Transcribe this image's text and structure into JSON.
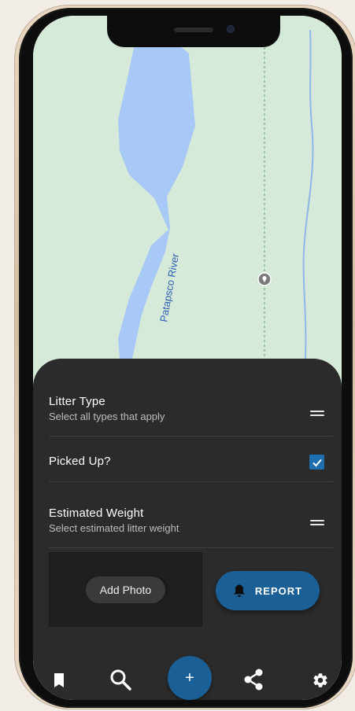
{
  "map": {
    "river_label": "Patapsco River",
    "colors": {
      "land": "#d5ead8",
      "water": "#a8c8f7",
      "river_label": "#2f5fb6"
    }
  },
  "form": {
    "litter_type": {
      "title": "Litter Type",
      "subtitle": "Select all types that apply"
    },
    "picked_up": {
      "title": "Picked Up?",
      "checked": true
    },
    "estimated_weight": {
      "title": "Estimated Weight",
      "subtitle": "Select estimated litter weight"
    }
  },
  "actions": {
    "add_photo_label": "Add Photo",
    "report_label": "REPORT"
  },
  "nav": {
    "fab_label": "+",
    "icons": [
      "bookmark-icon",
      "search-icon",
      "add-icon",
      "share-icon",
      "gear-icon"
    ]
  },
  "theme": {
    "accent": "#1a5f96",
    "sheet": "#2b2b2b"
  }
}
